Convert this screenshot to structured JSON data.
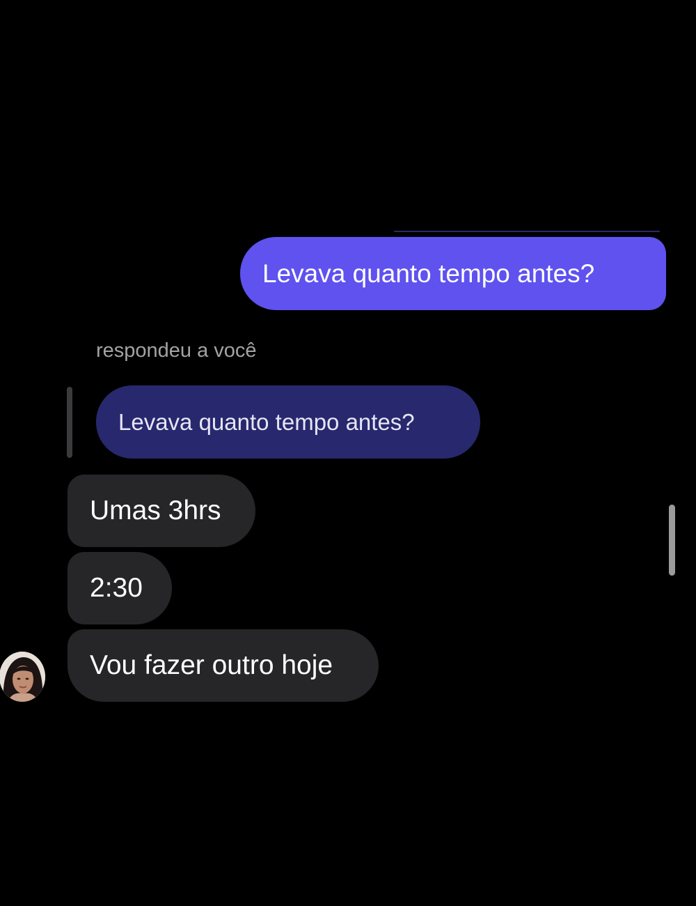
{
  "thread": {
    "outgoing_message": "Levava quanto tempo antes?",
    "reply_label": "respondeu a você",
    "quoted_message": "Levava quanto tempo antes?",
    "incoming_messages": [
      "Umas 3hrs",
      "2:30",
      "Vou fazer outro hoje"
    ]
  },
  "colors": {
    "background": "#000000",
    "outgoing_bubble": "#5f52ef",
    "quoted_bubble": "#28286e",
    "incoming_bubble": "#262628",
    "reply_label": "#a3a3a3"
  },
  "icons": {
    "avatar": "contact-avatar-photo"
  }
}
